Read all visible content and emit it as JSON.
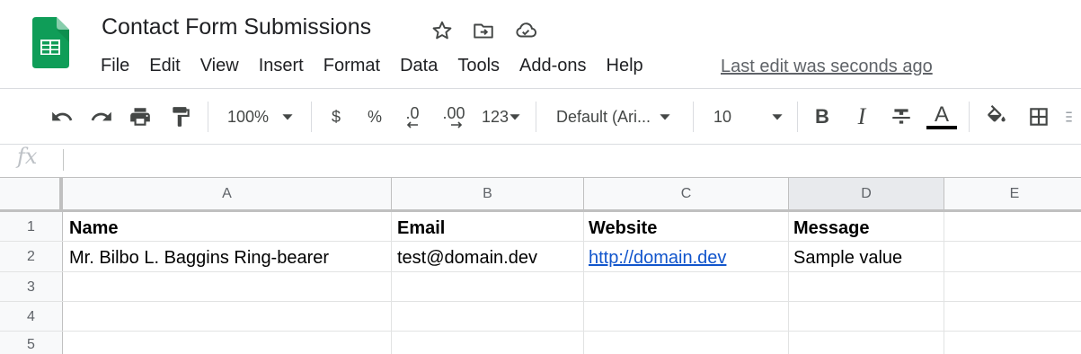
{
  "document": {
    "title": "Contact Form Submissions",
    "last_edit": "Last edit was seconds ago"
  },
  "header_icons": [
    "star-icon",
    "move-to-folder-icon",
    "cloud-saved-icon"
  ],
  "menu": [
    "File",
    "Edit",
    "View",
    "Insert",
    "Format",
    "Data",
    "Tools",
    "Add-ons",
    "Help"
  ],
  "toolbar": {
    "zoom": "100%",
    "currency": "$",
    "percent": "%",
    "decrease_decimal": ".0",
    "increase_decimal": ".00",
    "more_formats": "123",
    "font": "Default (Ari...",
    "font_size": "10",
    "bold": "B",
    "italic": "I",
    "text_color": "A",
    "text_color_swatch": "#000000"
  },
  "formula_bar": {
    "fx_label": "fx",
    "value": ""
  },
  "sheet": {
    "columns": [
      "A",
      "B",
      "C",
      "D",
      "E"
    ],
    "selected_column": "D",
    "rows": [
      "1",
      "2",
      "3",
      "4",
      "5"
    ],
    "header_row": {
      "A": "Name",
      "B": "Email",
      "C": "Website",
      "D": "Message"
    },
    "data_row": {
      "A": "Mr. Bilbo L. Baggins Ring-bearer",
      "B": "test@domain.dev",
      "C": "http://domain.dev",
      "D": "Sample value"
    }
  },
  "colors": {
    "link": "#1155cc",
    "logo_green": "#0f9d58"
  }
}
